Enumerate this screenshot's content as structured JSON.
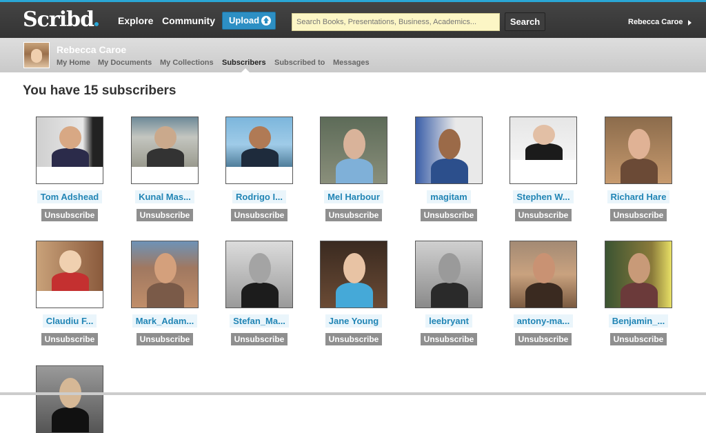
{
  "header": {
    "logo": "Scribd",
    "nav": [
      "Explore",
      "Community"
    ],
    "upload_label": "Upload",
    "search_placeholder": "Search Books, Presentations, Business, Academics...",
    "search_button": "Search",
    "user_name": "Rebecca Caroe"
  },
  "profile": {
    "name": "Rebecca Caroe",
    "tabs": [
      "My Home",
      "My Documents",
      "My Collections",
      "Subscribers",
      "Subscribed to",
      "Messages"
    ],
    "active_tab": "Subscribers"
  },
  "main": {
    "title": "You have 15 subscribers",
    "unsubscribe_label": "Unsubscribe",
    "subscribers": [
      {
        "name": "Tom Adshead"
      },
      {
        "name": "Kunal Mas..."
      },
      {
        "name": "Rodrigo I..."
      },
      {
        "name": "Mel Harbour"
      },
      {
        "name": "magitam"
      },
      {
        "name": "Stephen W..."
      },
      {
        "name": "Richard Hare"
      },
      {
        "name": "Claudiu F..."
      },
      {
        "name": "Mark_Adam..."
      },
      {
        "name": "Stefan_Ma..."
      },
      {
        "name": "Jane Young"
      },
      {
        "name": "leebryant"
      },
      {
        "name": "antony-ma..."
      },
      {
        "name": "Benjamin_..."
      },
      {
        "name": ""
      }
    ]
  },
  "colors": {
    "topbar": "#3b3b3b",
    "accent": "#2aa7d6",
    "link": "#2185b5",
    "unsubscribe_bg": "#8f8f8f"
  }
}
